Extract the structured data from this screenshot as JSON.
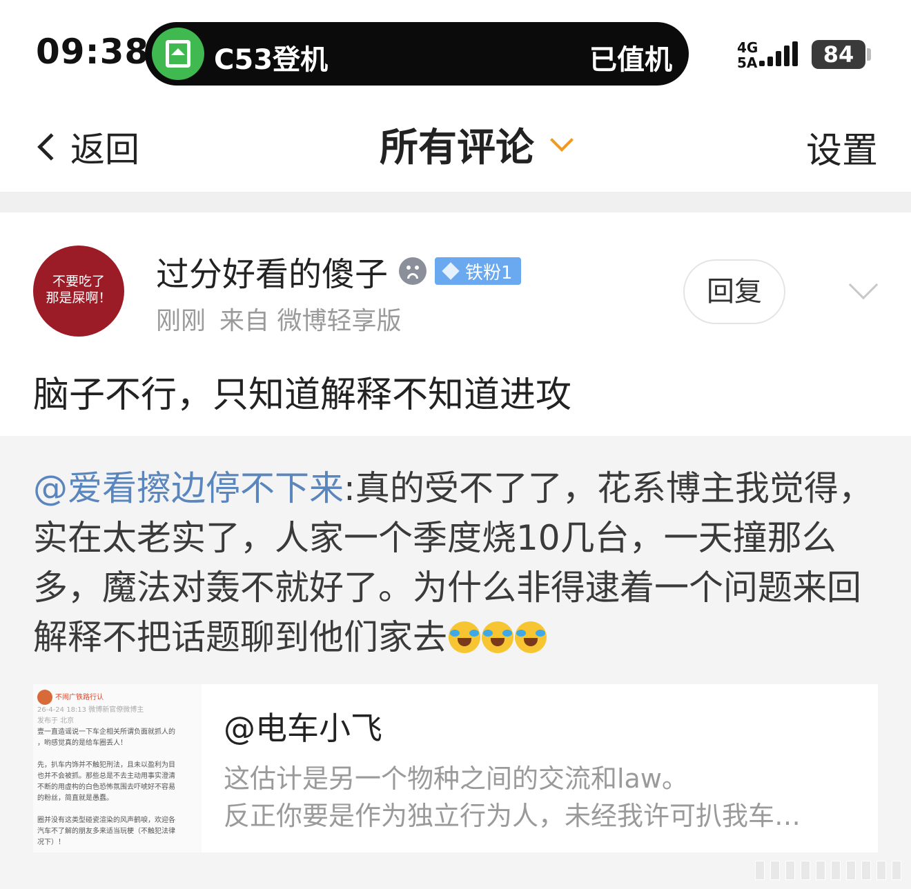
{
  "status_bar": {
    "time": "09:38",
    "island": {
      "left_text": "C53登机",
      "right_text": "已值机"
    },
    "network": "4G\n5A",
    "battery": "84"
  },
  "nav": {
    "back_label": "返回",
    "title": "所有评论",
    "settings_label": "设置"
  },
  "comment": {
    "avatar_text": "不要吃了\n那是屎啊！",
    "username": "过分好看的傻子",
    "fan_badge": "铁粉1",
    "time": "刚刚",
    "source": "来自 微博轻享版",
    "reply_label": "回复",
    "text": "脑子不行，只知道解释不知道进攻"
  },
  "quote": {
    "mention": "@爱看擦边停不下来",
    "text": ":真的受不了了，花系博主我觉得，实在太老实了，人家一个季度烧10几台，一天撞那么多，魔法对轰不就好了。为什么非得逮着一个问题来回解释不把话题聊到他们家去",
    "emoji": "laugh-cry",
    "emoji_count": 3,
    "card": {
      "author": "@电车小飞",
      "line1": "这估计是另一个物种之间的交流和law。",
      "line2": "反正你要是作为独立行为人，未经我许可扒我车…",
      "thumb_lines": [
        "不闹广铁路行认",
        "26-4-24 18:13  微博新官僚微博主",
        "发布于 北京",
        "壹一直造谣说一下车企相关所谓负面就抓人的",
        "，哟感觉真的是给车圈丢人！",
        "",
        "先，扒车内饰并不触犯刑法，且未以盈利为目",
        "也并不会被抓。那些总是不去主动用事实澄清",
        "不断的用虚构的白色恐怖氛围去吓唬好不容易",
        "的粉丝，简直就是愚蠢。",
        "",
        "圈并没有这类型碰瓷渲染的风声鹤唳，欢迎各",
        "汽车不了解的朋友多来适当玩梗（不触犯法律",
        "况下）！"
      ]
    }
  }
}
